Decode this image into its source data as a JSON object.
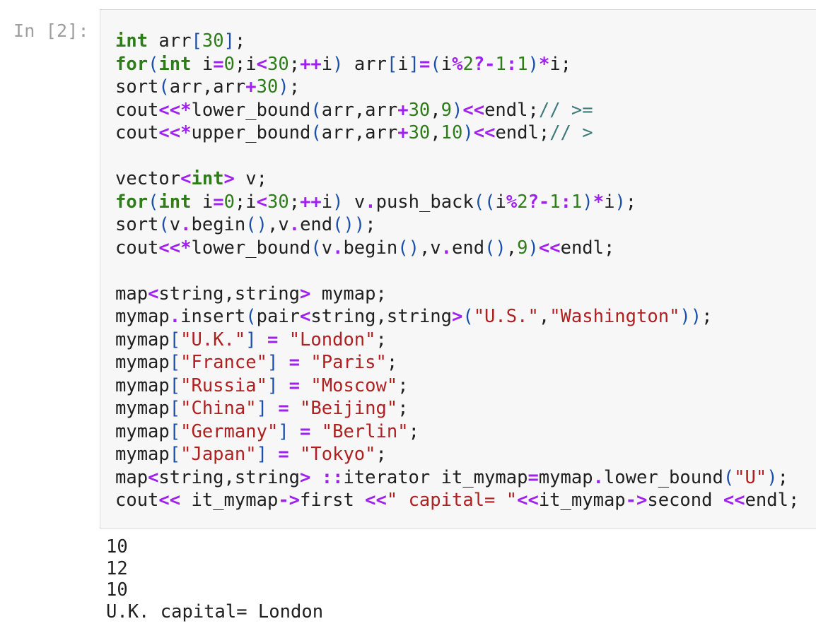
{
  "cell": {
    "prompt": "In [2]:",
    "lines": [
      [
        [
          "kw",
          "int"
        ],
        [
          "t",
          " arr"
        ],
        [
          "br",
          "["
        ],
        [
          "num",
          "30"
        ],
        [
          "br",
          "]"
        ],
        [
          "t",
          ";"
        ]
      ],
      [
        [
          "kw",
          "for"
        ],
        [
          "br",
          "("
        ],
        [
          "kw",
          "int"
        ],
        [
          "t",
          " i"
        ],
        [
          "op",
          "="
        ],
        [
          "num",
          "0"
        ],
        [
          "t",
          ";i"
        ],
        [
          "op",
          "<"
        ],
        [
          "num",
          "30"
        ],
        [
          "t",
          ";"
        ],
        [
          "op",
          "++"
        ],
        [
          "t",
          "i"
        ],
        [
          "br",
          ")"
        ],
        [
          "t",
          " arr"
        ],
        [
          "br",
          "["
        ],
        [
          "t",
          "i"
        ],
        [
          "br",
          "]"
        ],
        [
          "op",
          "="
        ],
        [
          "br",
          "("
        ],
        [
          "t",
          "i"
        ],
        [
          "op",
          "%"
        ],
        [
          "num",
          "2"
        ],
        [
          "op",
          "?-"
        ],
        [
          "num",
          "1"
        ],
        [
          "op",
          ":"
        ],
        [
          "num",
          "1"
        ],
        [
          "br",
          ")"
        ],
        [
          "op",
          "*"
        ],
        [
          "t",
          "i;"
        ]
      ],
      [
        [
          "t",
          "sort"
        ],
        [
          "br",
          "("
        ],
        [
          "t",
          "arr,arr"
        ],
        [
          "op",
          "+"
        ],
        [
          "num",
          "30"
        ],
        [
          "br",
          ")"
        ],
        [
          "t",
          ";"
        ]
      ],
      [
        [
          "t",
          "cout"
        ],
        [
          "op",
          "<<*"
        ],
        [
          "t",
          "lower_bound"
        ],
        [
          "br",
          "("
        ],
        [
          "t",
          "arr,arr"
        ],
        [
          "op",
          "+"
        ],
        [
          "num",
          "30"
        ],
        [
          "t",
          ","
        ],
        [
          "num",
          "9"
        ],
        [
          "br",
          ")"
        ],
        [
          "op",
          "<<"
        ],
        [
          "t",
          "endl;"
        ],
        [
          "cmt",
          "// >="
        ]
      ],
      [
        [
          "t",
          "cout"
        ],
        [
          "op",
          "<<*"
        ],
        [
          "t",
          "upper_bound"
        ],
        [
          "br",
          "("
        ],
        [
          "t",
          "arr,arr"
        ],
        [
          "op",
          "+"
        ],
        [
          "num",
          "30"
        ],
        [
          "t",
          ","
        ],
        [
          "num",
          "10"
        ],
        [
          "br",
          ")"
        ],
        [
          "op",
          "<<"
        ],
        [
          "t",
          "endl;"
        ],
        [
          "cmt",
          "// >"
        ]
      ],
      [],
      [
        [
          "t",
          "vector"
        ],
        [
          "op",
          "<"
        ],
        [
          "kw",
          "int"
        ],
        [
          "op",
          ">"
        ],
        [
          "t",
          " v;"
        ]
      ],
      [
        [
          "kw",
          "for"
        ],
        [
          "br",
          "("
        ],
        [
          "kw",
          "int"
        ],
        [
          "t",
          " i"
        ],
        [
          "op",
          "="
        ],
        [
          "num",
          "0"
        ],
        [
          "t",
          ";i"
        ],
        [
          "op",
          "<"
        ],
        [
          "num",
          "30"
        ],
        [
          "t",
          ";"
        ],
        [
          "op",
          "++"
        ],
        [
          "t",
          "i"
        ],
        [
          "br",
          ")"
        ],
        [
          "t",
          " v"
        ],
        [
          "op",
          "."
        ],
        [
          "t",
          "push_back"
        ],
        [
          "br",
          "(("
        ],
        [
          "t",
          "i"
        ],
        [
          "op",
          "%"
        ],
        [
          "num",
          "2"
        ],
        [
          "op",
          "?-"
        ],
        [
          "num",
          "1"
        ],
        [
          "op",
          ":"
        ],
        [
          "num",
          "1"
        ],
        [
          "br",
          ")"
        ],
        [
          "op",
          "*"
        ],
        [
          "t",
          "i"
        ],
        [
          "br",
          ")"
        ],
        [
          "t",
          ";"
        ]
      ],
      [
        [
          "t",
          "sort"
        ],
        [
          "br",
          "("
        ],
        [
          "t",
          "v"
        ],
        [
          "op",
          "."
        ],
        [
          "t",
          "begin"
        ],
        [
          "br",
          "()"
        ],
        [
          "t",
          ",v"
        ],
        [
          "op",
          "."
        ],
        [
          "t",
          "end"
        ],
        [
          "br",
          "())"
        ],
        [
          "t",
          ";"
        ]
      ],
      [
        [
          "t",
          "cout"
        ],
        [
          "op",
          "<<*"
        ],
        [
          "t",
          "lower_bound"
        ],
        [
          "br",
          "("
        ],
        [
          "t",
          "v"
        ],
        [
          "op",
          "."
        ],
        [
          "t",
          "begin"
        ],
        [
          "br",
          "()"
        ],
        [
          "t",
          ",v"
        ],
        [
          "op",
          "."
        ],
        [
          "t",
          "end"
        ],
        [
          "br",
          "()"
        ],
        [
          "t",
          ","
        ],
        [
          "num",
          "9"
        ],
        [
          "br",
          ")"
        ],
        [
          "op",
          "<<"
        ],
        [
          "t",
          "endl;"
        ]
      ],
      [],
      [
        [
          "t",
          "map"
        ],
        [
          "op",
          "<"
        ],
        [
          "t",
          "string,string"
        ],
        [
          "op",
          ">"
        ],
        [
          "t",
          " mymap;"
        ]
      ],
      [
        [
          "t",
          "mymap"
        ],
        [
          "op",
          "."
        ],
        [
          "t",
          "insert"
        ],
        [
          "br",
          "("
        ],
        [
          "t",
          "pair"
        ],
        [
          "op",
          "<"
        ],
        [
          "t",
          "string,string"
        ],
        [
          "op",
          ">"
        ],
        [
          "br",
          "("
        ],
        [
          "str",
          "\"U.S.\""
        ],
        [
          "t",
          ","
        ],
        [
          "str",
          "\"Washington\""
        ],
        [
          "br",
          "))"
        ],
        [
          "t",
          ";"
        ]
      ],
      [
        [
          "t",
          "mymap"
        ],
        [
          "br",
          "["
        ],
        [
          "str",
          "\"U.K.\""
        ],
        [
          "br",
          "]"
        ],
        [
          "t",
          " "
        ],
        [
          "op",
          "="
        ],
        [
          "t",
          " "
        ],
        [
          "str",
          "\"London\""
        ],
        [
          "t",
          ";"
        ]
      ],
      [
        [
          "t",
          "mymap"
        ],
        [
          "br",
          "["
        ],
        [
          "str",
          "\"France\""
        ],
        [
          "br",
          "]"
        ],
        [
          "t",
          " "
        ],
        [
          "op",
          "="
        ],
        [
          "t",
          " "
        ],
        [
          "str",
          "\"Paris\""
        ],
        [
          "t",
          ";"
        ]
      ],
      [
        [
          "t",
          "mymap"
        ],
        [
          "br",
          "["
        ],
        [
          "str",
          "\"Russia\""
        ],
        [
          "br",
          "]"
        ],
        [
          "t",
          " "
        ],
        [
          "op",
          "="
        ],
        [
          "t",
          " "
        ],
        [
          "str",
          "\"Moscow\""
        ],
        [
          "t",
          ";"
        ]
      ],
      [
        [
          "t",
          "mymap"
        ],
        [
          "br",
          "["
        ],
        [
          "str",
          "\"China\""
        ],
        [
          "br",
          "]"
        ],
        [
          "t",
          " "
        ],
        [
          "op",
          "="
        ],
        [
          "t",
          " "
        ],
        [
          "str",
          "\"Beijing\""
        ],
        [
          "t",
          ";"
        ]
      ],
      [
        [
          "t",
          "mymap"
        ],
        [
          "br",
          "["
        ],
        [
          "str",
          "\"Germany\""
        ],
        [
          "br",
          "]"
        ],
        [
          "t",
          " "
        ],
        [
          "op",
          "="
        ],
        [
          "t",
          " "
        ],
        [
          "str",
          "\"Berlin\""
        ],
        [
          "t",
          ";"
        ]
      ],
      [
        [
          "t",
          "mymap"
        ],
        [
          "br",
          "["
        ],
        [
          "str",
          "\"Japan\""
        ],
        [
          "br",
          "]"
        ],
        [
          "t",
          " "
        ],
        [
          "op",
          "="
        ],
        [
          "t",
          " "
        ],
        [
          "str",
          "\"Tokyo\""
        ],
        [
          "t",
          ";"
        ]
      ],
      [
        [
          "t",
          "map"
        ],
        [
          "op",
          "<"
        ],
        [
          "t",
          "string,string"
        ],
        [
          "op",
          "> ::"
        ],
        [
          "t",
          "iterator it_mymap"
        ],
        [
          "op",
          "="
        ],
        [
          "t",
          "mymap"
        ],
        [
          "op",
          "."
        ],
        [
          "t",
          "lower_bound"
        ],
        [
          "br",
          "("
        ],
        [
          "str",
          "\"U\""
        ],
        [
          "br",
          ")"
        ],
        [
          "t",
          ";"
        ]
      ],
      [
        [
          "t",
          "cout"
        ],
        [
          "op",
          "<<"
        ],
        [
          "t",
          " it_mymap"
        ],
        [
          "op",
          "->"
        ],
        [
          "t",
          "first "
        ],
        [
          "op",
          "<<"
        ],
        [
          "str",
          "\" capital= \""
        ],
        [
          "op",
          "<<"
        ],
        [
          "t",
          "it_mymap"
        ],
        [
          "op",
          "->"
        ],
        [
          "t",
          "second "
        ],
        [
          "op",
          "<<"
        ],
        [
          "t",
          "endl;"
        ]
      ]
    ]
  },
  "output": {
    "lines": [
      "10",
      "12",
      "10",
      "U.K. capital= London"
    ]
  },
  "colors": {
    "keyword": "#2e7d1a",
    "operator": "#a020f0",
    "number": "#2e7d1a",
    "string": "#b02020",
    "comment": "#3d7a7a",
    "bracket": "#1a50a8",
    "cell_background": "#f7f7f7",
    "prompt": "#9e9e9e"
  }
}
